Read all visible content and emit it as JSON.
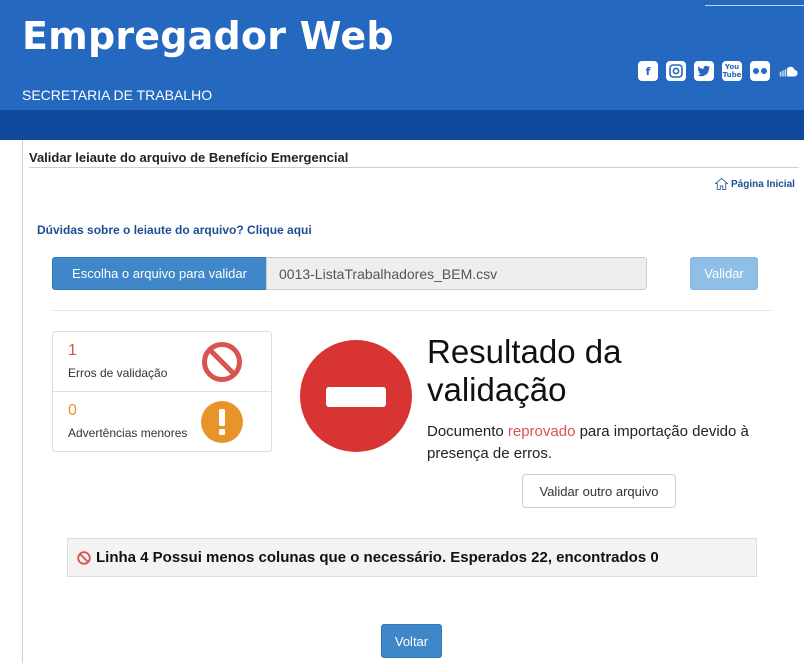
{
  "header": {
    "title": "Empregador Web",
    "subtitle": "SECRETARIA DE TRABALHO",
    "social_icons": [
      "facebook-icon",
      "instagram-icon",
      "twitter-icon",
      "youtube-icon",
      "flickr-icon",
      "soundcloud-icon"
    ],
    "youtube_label_top": "You",
    "youtube_label_bottom": "Tube",
    "colors": {
      "primary": "#2468c0",
      "band": "#0f4a9c"
    }
  },
  "page": {
    "title": "Validar leiaute do arquivo de Benefício Emergencial",
    "home_link": "Página Inicial",
    "help_link": "Dúvidas sobre o leiaute do arquivo? Clique aqui"
  },
  "upload": {
    "choose_label": "Escolha o arquivo para validar",
    "file_name": "0013-ListaTrabalhadores_BEM.csv",
    "validate_label": "Validar"
  },
  "stats": {
    "errors": {
      "value": "1",
      "label": "Erros de validação",
      "color": "#d9534f"
    },
    "warnings": {
      "value": "0",
      "label": "Advertências menores",
      "color": "#e8942a"
    }
  },
  "result": {
    "title": "Resultado da validação",
    "text_before": "Documento ",
    "text_status": "reprovado",
    "text_after": " para importação devido à presença de erros.",
    "other_file_label": "Validar outro arquivo"
  },
  "error_message": "Linha 4 Possui menos colunas que o necessário. Esperados 22, encontrados 0",
  "footer": {
    "back_label": "Voltar"
  }
}
